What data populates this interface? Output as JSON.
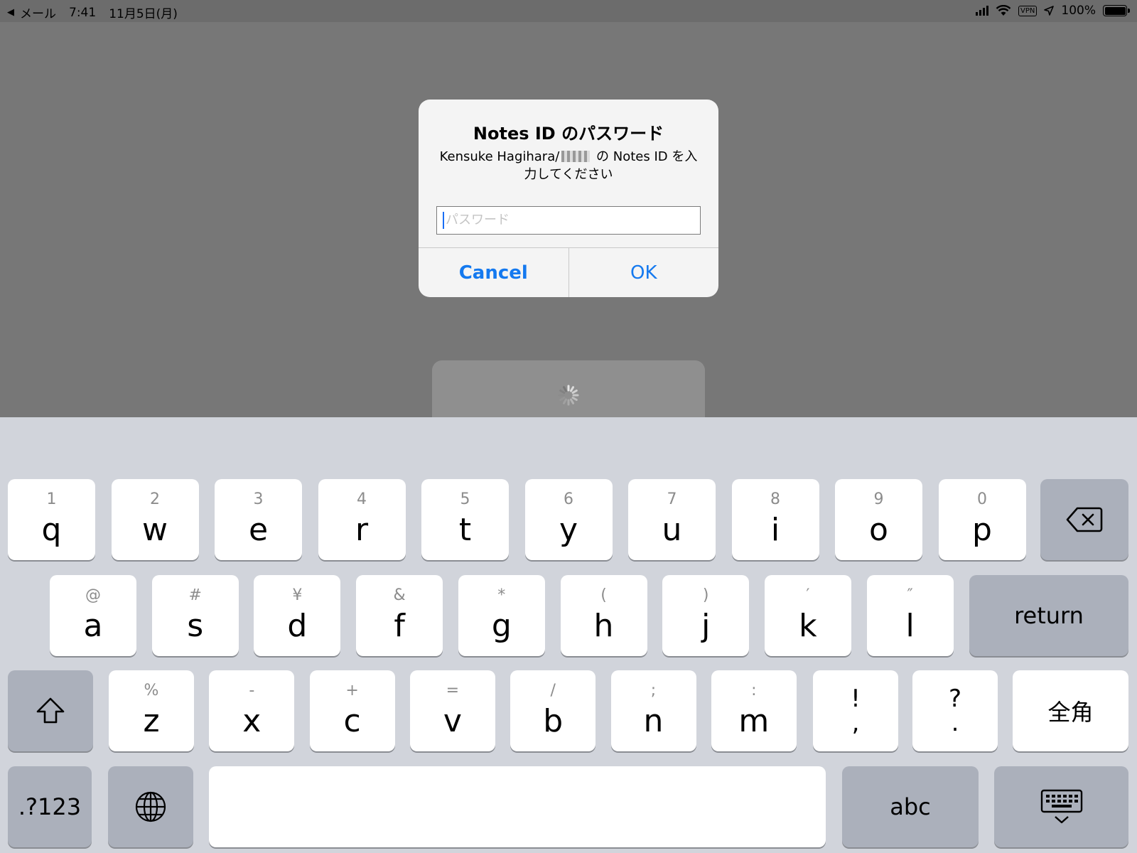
{
  "status_bar": {
    "back_arrow": "◀",
    "back_app": "メール",
    "time": "7:41",
    "date": "11月5日(月)",
    "vpn": "VPN",
    "battery": "100%",
    "battery_level": 1.0,
    "icons": [
      "signal-icon",
      "wifi-icon",
      "vpn-icon",
      "location-icon",
      "battery-icon"
    ]
  },
  "alert": {
    "title": "Notes ID のパスワード",
    "message_prefix": "Kensuke Hagihara/",
    "message_suffix": " の Notes ID を入力してください",
    "password_placeholder": "パスワード",
    "cancel_label": "Cancel",
    "ok_label": "OK"
  },
  "keyboard": {
    "row1": [
      {
        "sub": "1",
        "main": "q"
      },
      {
        "sub": "2",
        "main": "w"
      },
      {
        "sub": "3",
        "main": "e"
      },
      {
        "sub": "4",
        "main": "r"
      },
      {
        "sub": "5",
        "main": "t"
      },
      {
        "sub": "6",
        "main": "y"
      },
      {
        "sub": "7",
        "main": "u"
      },
      {
        "sub": "8",
        "main": "i"
      },
      {
        "sub": "9",
        "main": "o"
      },
      {
        "sub": "0",
        "main": "p"
      }
    ],
    "row2": [
      {
        "sub": "@",
        "main": "a"
      },
      {
        "sub": "#",
        "main": "s"
      },
      {
        "sub": "¥",
        "main": "d"
      },
      {
        "sub": "&",
        "main": "f"
      },
      {
        "sub": "*",
        "main": "g"
      },
      {
        "sub": "(",
        "main": "h"
      },
      {
        "sub": ")",
        "main": "j"
      },
      {
        "sub": "′",
        "main": "k"
      },
      {
        "sub": "″",
        "main": "l"
      }
    ],
    "row3": [
      {
        "sub": "%",
        "main": "z"
      },
      {
        "sub": "-",
        "main": "x"
      },
      {
        "sub": "+",
        "main": "c"
      },
      {
        "sub": "=",
        "main": "v"
      },
      {
        "sub": "/",
        "main": "b"
      },
      {
        "sub": ";",
        "main": "n"
      },
      {
        "sub": ":",
        "main": "m"
      }
    ],
    "punct": [
      {
        "top": "!",
        "bottom": ","
      },
      {
        "top": "?",
        "bottom": "."
      }
    ],
    "return_label": "return",
    "zenkaku_label": "全角",
    "numbers_label": ".?123",
    "abc_label": "abc"
  }
}
